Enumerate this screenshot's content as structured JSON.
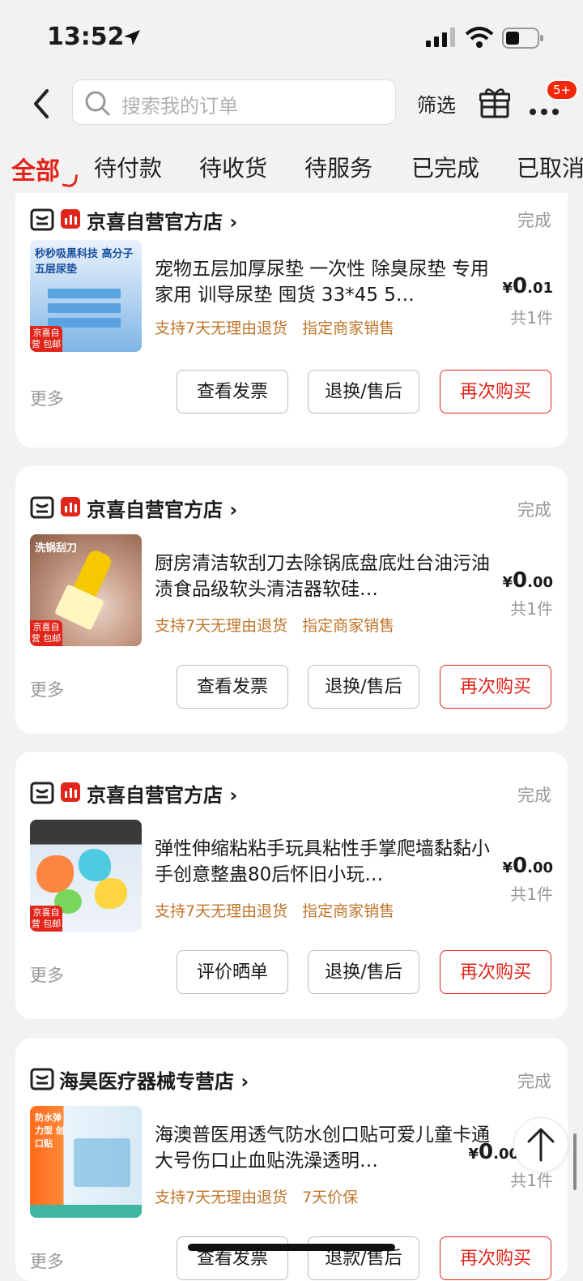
{
  "status_bar": {
    "time": "13:52"
  },
  "search": {
    "placeholder": "搜索我的订单",
    "filter_label": "筛选",
    "badge": "5+"
  },
  "tabs": [
    {
      "label": "全部"
    },
    {
      "label": "待付款"
    },
    {
      "label": "待收货"
    },
    {
      "label": "待服务"
    },
    {
      "label": "已完成"
    },
    {
      "label": "已取消"
    }
  ],
  "orders": [
    {
      "shop": "京喜自营官方店",
      "status": "完成",
      "thumb_text": "秒秒吸黑科技 高分子五层尿垫",
      "thumb_tag": "京喜自营 包邮",
      "title": "宠物五层加厚尿垫 一次性 除臭尿垫 专用家用 训导尿垫 囤货 33*45 5…",
      "tags": [
        "支持7天无理由退货",
        "指定商家销售"
      ],
      "price_symbol": "¥",
      "price_int": "0",
      "price_dec": ".01",
      "count": "共1件",
      "more": "更多",
      "buttons": [
        "查看发票",
        "退换/售后",
        "再次购买"
      ]
    },
    {
      "shop": "京喜自营官方店",
      "status": "完成",
      "thumb_text": "洗锅刮刀",
      "thumb_tag": "京喜自营 包邮",
      "title": "厨房清洁软刮刀去除锅底盘底灶台油污油渍食品级软头清洁器软硅…",
      "tags": [
        "支持7天无理由退货",
        "指定商家销售"
      ],
      "price_symbol": "¥",
      "price_int": "0",
      "price_dec": ".00",
      "count": "共1件",
      "more": "更多",
      "buttons": [
        "查看发票",
        "退换/售后",
        "再次购买"
      ]
    },
    {
      "shop": "京喜自营官方店",
      "status": "完成",
      "thumb_text": "",
      "thumb_tag": "京喜自营 包邮",
      "title": "弹性伸缩粘粘手玩具粘性手掌爬墙黏黏小手创意整蛊80后怀旧小玩…",
      "tags": [
        "支持7天无理由退货",
        "指定商家销售"
      ],
      "price_symbol": "¥",
      "price_int": "0",
      "price_dec": ".00",
      "count": "共1件",
      "more": "更多",
      "buttons": [
        "评价晒单",
        "退换/售后",
        "再次购买"
      ]
    },
    {
      "shop": "海昊医疗器械专营店",
      "status": "完成",
      "thumb_text": "防水弹力型 创口贴",
      "thumb_tag": "",
      "title": "海澳普医用透气防水创口贴可爱儿童卡通大号伤口止血贴洗澡透明…",
      "tags": [
        "支持7天无理由退货",
        "7天价保"
      ],
      "price_symbol": "¥",
      "price_int": "0",
      "price_dec": ".00",
      "count": "共1件",
      "more": "更多",
      "buttons": [
        "查看发票",
        "退款/售后",
        "再次购买"
      ]
    }
  ],
  "colors": {
    "accent": "#e1251b",
    "tag_orange": "#c0762b",
    "muted": "#999999"
  }
}
